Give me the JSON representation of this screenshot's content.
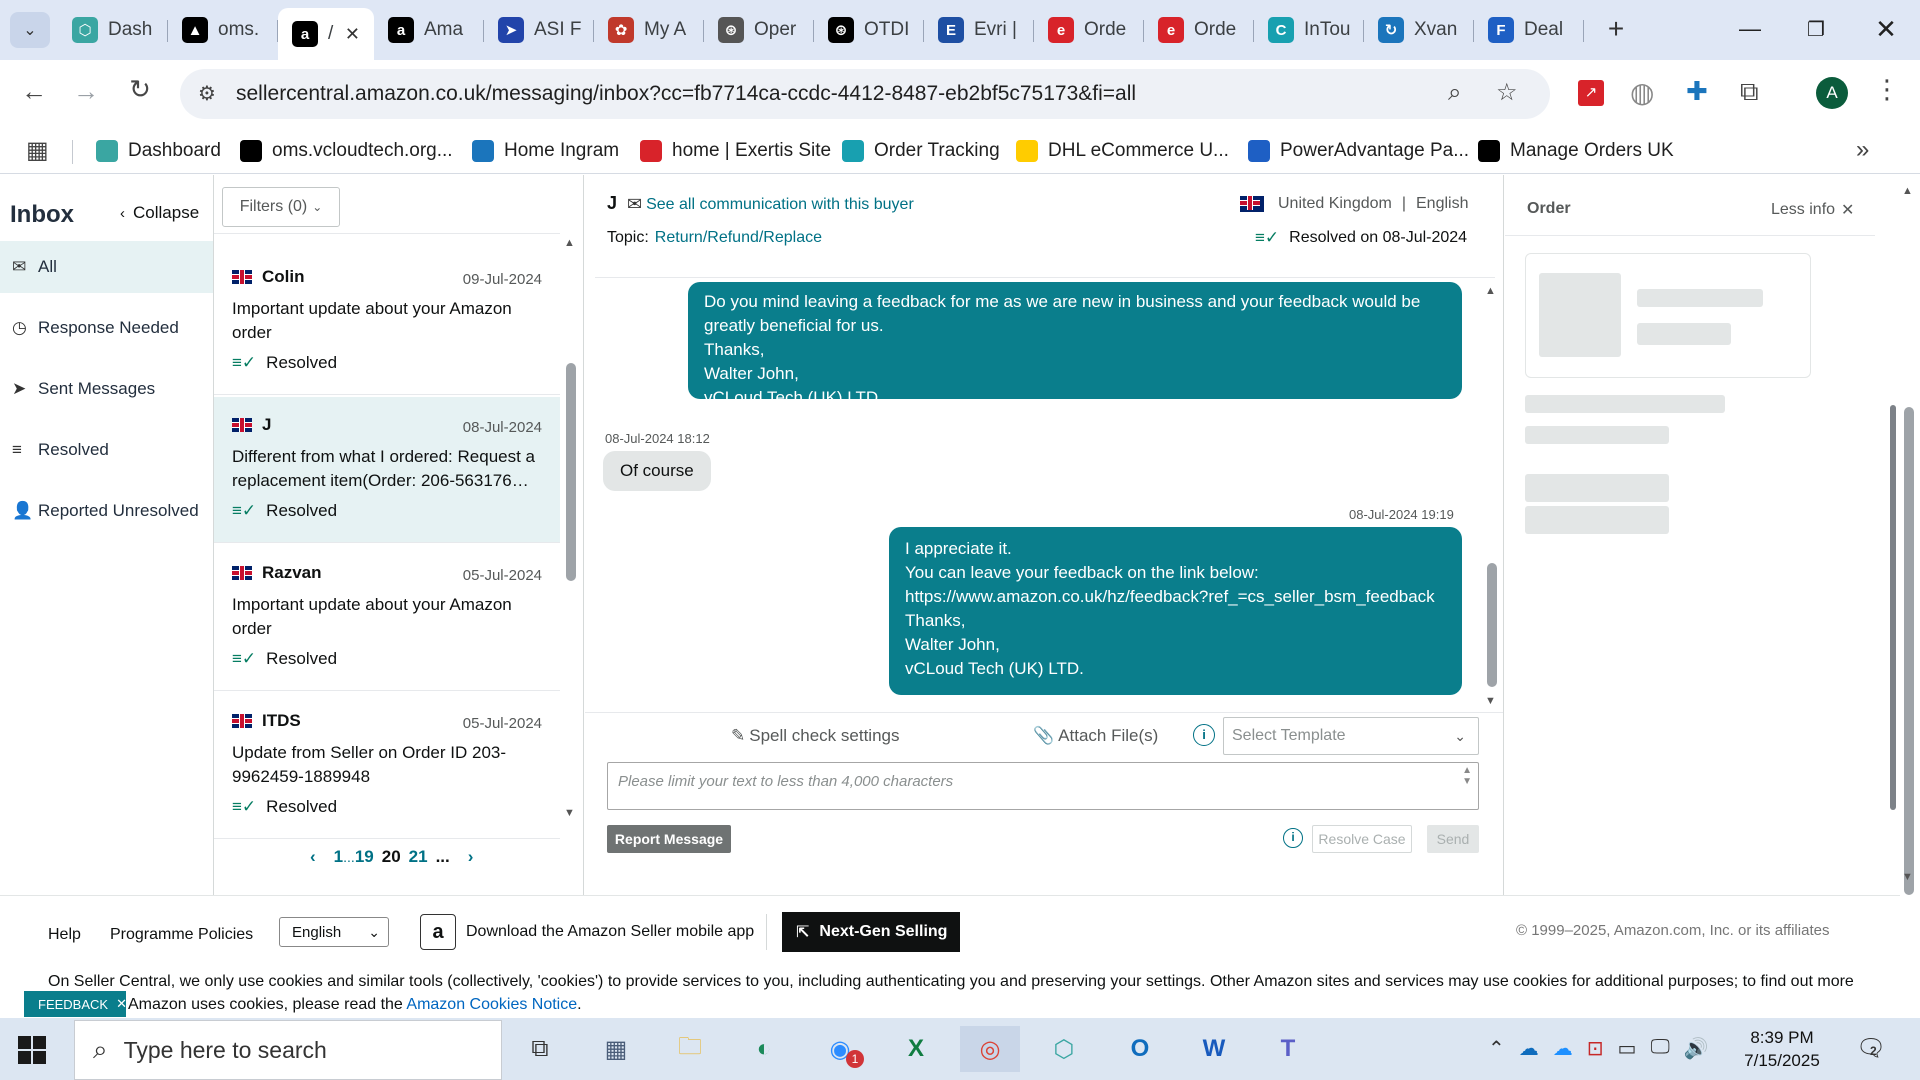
{
  "browser": {
    "tabs": [
      {
        "label": "Dash",
        "color": "#3aa6a2",
        "glyph": "⬡"
      },
      {
        "label": "oms.",
        "color": "#000000",
        "glyph": "▲"
      },
      {
        "label": "/",
        "color": "#000000",
        "glyph": "a",
        "active": true
      },
      {
        "label": "Ama",
        "color": "#000000",
        "glyph": "a"
      },
      {
        "label": "ASI F",
        "color": "#2244aa",
        "glyph": "➤"
      },
      {
        "label": "My A",
        "color": "#c0392b",
        "glyph": "✿"
      },
      {
        "label": "Oper",
        "color": "#555555",
        "glyph": "⊛"
      },
      {
        "label": "OTDI",
        "color": "#000000",
        "glyph": "⊛"
      },
      {
        "label": "Evri |",
        "color": "#1e4fa3",
        "glyph": "E"
      },
      {
        "label": "Orde",
        "color": "#d8232a",
        "glyph": "e"
      },
      {
        "label": "Orde",
        "color": "#d8232a",
        "glyph": "e"
      },
      {
        "label": "InTou",
        "color": "#18a0b0",
        "glyph": "C"
      },
      {
        "label": "Xvan",
        "color": "#1b75bc",
        "glyph": "↻"
      },
      {
        "label": "Deal",
        "color": "#1e5fc4",
        "glyph": "F"
      }
    ],
    "url": "sellercentral.amazon.co.uk/messaging/inbox?cc=fb7714ca-ccdc-4412-8487-eb2bf5c75173&fi=all",
    "profile_letter": "A",
    "bookmarks": [
      {
        "label": "Dashboard",
        "color": "#3aa6a2"
      },
      {
        "label": "oms.vcloudtech.org...",
        "color": "#000000"
      },
      {
        "label": "Home Ingram",
        "color": "#1b75bc"
      },
      {
        "label": "home | Exertis Site",
        "color": "#d8232a"
      },
      {
        "label": "Order Tracking",
        "color": "#18a0b0"
      },
      {
        "label": "DHL eCommerce U...",
        "color": "#ffcc00"
      },
      {
        "label": "PowerAdvantage Pa...",
        "color": "#1e5fc4"
      },
      {
        "label": "Manage Orders UK",
        "color": "#000000"
      }
    ]
  },
  "sidebar": {
    "title": "Inbox",
    "collapse_label": "Collapse",
    "items": [
      {
        "label": "All",
        "icon": "✉"
      },
      {
        "label": "Response Needed",
        "icon": "◷"
      },
      {
        "label": "Sent Messages",
        "icon": "➤"
      },
      {
        "label": "Resolved",
        "icon": "≡"
      },
      {
        "label": "Reported Unresolved",
        "icon": "👤"
      }
    ]
  },
  "list": {
    "filters_label": "Filters (0)",
    "conversations": [
      {
        "name": "Colin",
        "date": "09-Jul-2024",
        "subject": "Important update about your Amazon order",
        "status": "Resolved"
      },
      {
        "name": "J",
        "date": "08-Jul-2024",
        "subject": "Different from what I ordered: Request a replacement item(Order: 206-563176…",
        "status": "Resolved",
        "selected": true
      },
      {
        "name": "Razvan",
        "date": "05-Jul-2024",
        "subject": "Important update about your Amazon order",
        "status": "Resolved"
      },
      {
        "name": "ITDS",
        "date": "05-Jul-2024",
        "subject": "Update from Seller on Order ID 203-9962459-1889948",
        "status": "Resolved"
      }
    ],
    "pagination": {
      "first": "1",
      "ellipsis": "...",
      "p19": "19",
      "p20": "20",
      "p21": "21",
      "more": "..."
    }
  },
  "thread": {
    "buyer": "J",
    "see_all": "See all communication with this buyer",
    "country": "United Kingdom",
    "separator": "|",
    "language": "English",
    "topic_label": "Topic:",
    "topic": "Return/Refund/Replace",
    "resolved_on": "Resolved on 08-Jul-2024",
    "messages": [
      {
        "text": "Do you mind leaving a feedback for me as we are new in business and your feedback would be greatly beneficial for us.\nThanks,\nWalter John,\nvCLoud Tech (UK) LTD."
      },
      {
        "timestamp": "08-Jul-2024 18:12",
        "text": "Of course"
      },
      {
        "timestamp": "08-Jul-2024 19:19",
        "text": "I appreciate it.\nYou can leave your feedback on the link below:\nhttps://www.amazon.co.uk/hz/feedback?ref_=cs_seller_bsm_feedback\nThanks,\nWalter John,\nvCLoud Tech (UK) LTD."
      }
    ],
    "spell_check": "Spell check settings",
    "attach": "Attach File(s)",
    "template_placeholder": "Select Template",
    "text_placeholder": "Please limit your text to less than 4,000 characters",
    "report": "Report Message",
    "resolve": "Resolve Case",
    "send": "Send"
  },
  "order_panel": {
    "title": "Order",
    "less_info": "Less info"
  },
  "footer": {
    "help": "Help",
    "policies": "Programme Policies",
    "language": "English",
    "download_app": "Download the Amazon Seller mobile app",
    "next_gen": "Next-Gen Selling",
    "copyright": "© 1999–2025, Amazon.com, Inc. or its affiliates",
    "cookie_text": "On Seller Central, we only use cookies and similar tools (collectively, 'cookies') to provide services to you, including authenticating you and preserving your settings. Other Amazon sites and services may use cookies for additional purposes; to find out more",
    "cookie_text2": "Amazon uses cookies, please read the",
    "cookie_link": "Amazon Cookies Notice",
    "cookie_end": ".",
    "feedback": "FEEDBACK"
  },
  "taskbar": {
    "search_placeholder": "Type here to search",
    "time": "8:39 PM",
    "date": "7/15/2025",
    "notification_count": "2",
    "zoom_badge": "1"
  }
}
